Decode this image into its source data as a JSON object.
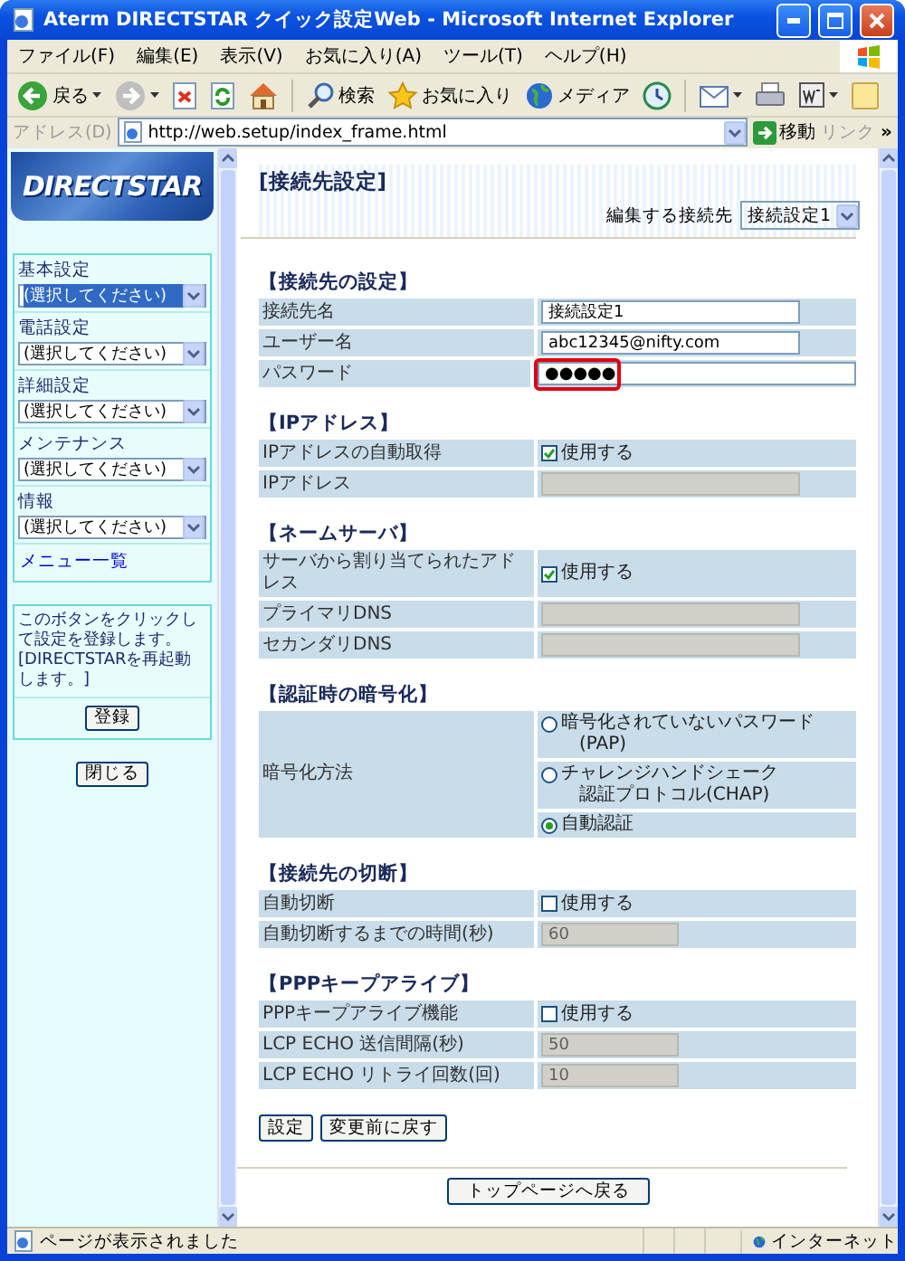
{
  "window": {
    "title": "Aterm DIRECTSTAR クイック設定Web - Microsoft Internet Explorer"
  },
  "menu": [
    "ファイル(F)",
    "編集(E)",
    "表示(V)",
    "お気に入り(A)",
    "ツール(T)",
    "ヘルプ(H)"
  ],
  "toolbar": {
    "back": "戻る",
    "search": "検索",
    "favorites": "お気に入り",
    "media": "メディア"
  },
  "address_bar": {
    "label": "アドレス(D)",
    "url": "http://web.setup/index_frame.html",
    "go": "移動",
    "links": "リンク",
    "more": "»"
  },
  "sidebar": {
    "logo": "DIRECTSTAR",
    "menus": [
      {
        "label": "基本設定",
        "value": "(選択してください)",
        "focused": true
      },
      {
        "label": "電話設定",
        "value": "(選択してください)",
        "focused": false
      },
      {
        "label": "詳細設定",
        "value": "(選択してください)",
        "focused": false
      },
      {
        "label": "メンテナンス",
        "value": "(選択してください)",
        "focused": false
      },
      {
        "label": "情報",
        "value": "(選択してください)",
        "focused": false
      }
    ],
    "menu_list_link": "メニュー一覧",
    "note": "このボタンをクリックして設定を登録します。[DIRECTSTARを再起動します。]",
    "register_button": "登録",
    "close_button": "閉じる"
  },
  "page": {
    "title": "[接続先設定]",
    "edit_target_label": "編集する接続先",
    "edit_target": "接続設定1",
    "sections": [
      {
        "title": "【接続先の設定】",
        "rows": [
          {
            "kind": "text",
            "label": "接続先名",
            "value": "接続設定1",
            "disabled": false
          },
          {
            "kind": "text",
            "label": "ユーザー名",
            "value": "abc12345@nifty.com",
            "disabled": false
          },
          {
            "kind": "password",
            "label": "パスワード",
            "value": "●●●●●",
            "highlighted": true
          }
        ]
      },
      {
        "title": "【IPアドレス】",
        "rows": [
          {
            "kind": "checkbox",
            "label": "IPアドレスの自動取得",
            "text": "使用する",
            "checked": true
          },
          {
            "kind": "text",
            "label": "IPアドレス",
            "disabled": true
          }
        ]
      },
      {
        "title": "【ネームサーバ】",
        "rows": [
          {
            "kind": "checkbox",
            "label": "サーバから割り当てられたアドレス",
            "text": "使用する",
            "checked": true
          },
          {
            "kind": "text",
            "label": "プライマリDNS",
            "disabled": true
          },
          {
            "kind": "text",
            "label": "セカンダリDNS",
            "disabled": true
          }
        ]
      },
      {
        "title": "【認証時の暗号化】",
        "rows": [
          {
            "kind": "radio",
            "label": "暗号化方法",
            "options": [
              {
                "lines": [
                  "暗号化されていないパスワード",
                  "(PAP)"
                ],
                "selected": false
              },
              {
                "lines": [
                  "チャレンジハンドシェーク",
                  "認証プロトコル(CHAP)"
                ],
                "selected": false
              },
              {
                "lines": [
                  "自動認証"
                ],
                "selected": true
              }
            ]
          }
        ]
      },
      {
        "title": "【接続先の切断】",
        "rows": [
          {
            "kind": "checkbox",
            "label": "自動切断",
            "text": "使用する",
            "checked": false
          },
          {
            "kind": "number",
            "label": "自動切断するまでの時間(秒)",
            "value": "60",
            "disabled": true
          }
        ]
      },
      {
        "title": "【PPPキープアライブ】",
        "rows": [
          {
            "kind": "checkbox",
            "label": "PPPキープアライブ機能",
            "text": "使用する",
            "checked": false
          },
          {
            "kind": "number",
            "label": "LCP ECHO 送信間隔(秒)",
            "value": "50",
            "disabled": true
          },
          {
            "kind": "number",
            "label": "LCP ECHO リトライ回数(回)",
            "value": "10",
            "disabled": true
          }
        ]
      }
    ],
    "buttons": [
      "設定",
      "変更前に戻す"
    ],
    "top_button": "トップページへ戻る"
  },
  "status_bar": {
    "text": "ページが表示されました",
    "zone": "インターネット"
  }
}
